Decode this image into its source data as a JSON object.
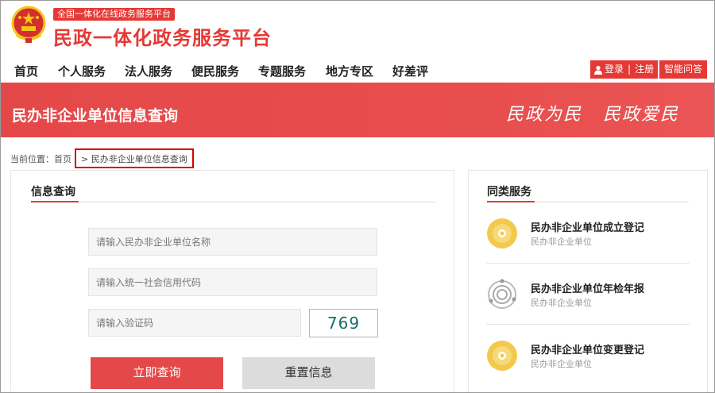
{
  "header": {
    "tagline": "全国一体化在线政务服务平台",
    "site_title": "民政一体化政务服务平台"
  },
  "nav": {
    "items": [
      {
        "label": "首页"
      },
      {
        "label": "个人服务"
      },
      {
        "label": "法人服务"
      },
      {
        "label": "便民服务"
      },
      {
        "label": "专题服务"
      },
      {
        "label": "地方专区"
      },
      {
        "label": "好差评"
      }
    ],
    "login": "登录",
    "separator": "|",
    "register": "注册",
    "qa": "智能问答"
  },
  "banner": {
    "title": "民办非企业单位信息查询",
    "slogan_1": "民政为民",
    "slogan_2": "民政爱民"
  },
  "breadcrumb": {
    "prefix": "当前位置：",
    "home": "首页",
    "arrow": ">",
    "current": "民办非企业单位信息查询"
  },
  "query_panel": {
    "title": "信息查询",
    "name_placeholder": "请输入民办非企业单位名称",
    "code_placeholder": "请输入统一社会信用代码",
    "captcha_placeholder": "请输入验证码",
    "captcha_value": "769",
    "query_button": "立即查询",
    "reset_button": "重置信息"
  },
  "related_panel": {
    "title": "同类服务",
    "items": [
      {
        "name": "民办非企业单位成立登记",
        "sub": "民办非企业单位",
        "icon": "sun-disc-icon"
      },
      {
        "name": "民办非企业单位年检年报",
        "sub": "民办非企业单位",
        "icon": "orbit-ring-icon"
      },
      {
        "name": "民办非企业单位变更登记",
        "sub": "民办非企业单位",
        "icon": "sun-disc-icon"
      }
    ]
  },
  "colors": {
    "brand_red": "#e53935",
    "banner_red": "#e54848",
    "reset_gray": "#dcdcdc",
    "emblem_gold": "#f5c518",
    "icon_gold": "#f2c94c"
  }
}
